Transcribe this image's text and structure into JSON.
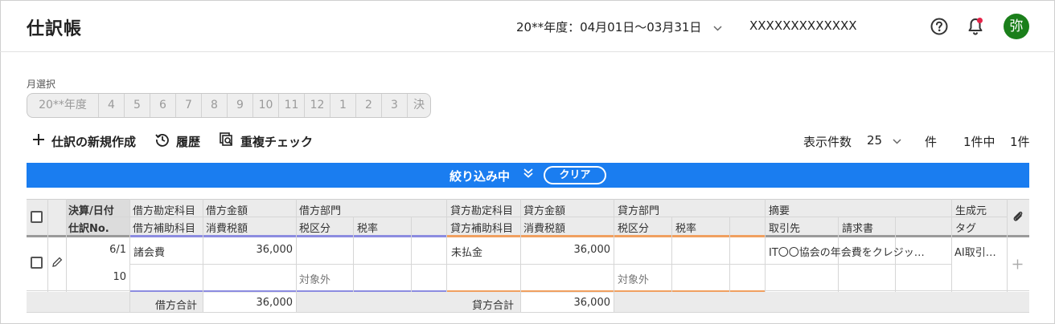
{
  "header": {
    "title": "仕訳帳",
    "fiscal_period": "20**年度：04月01日〜03月31日",
    "company": "XXXXXXXXXXXXX",
    "avatar_char": "弥"
  },
  "month_selector": {
    "label": "月選択",
    "months": [
      "20**年度",
      "4",
      "5",
      "6",
      "7",
      "8",
      "9",
      "10",
      "11",
      "12",
      "1",
      "2",
      "3",
      "決"
    ]
  },
  "toolbar": {
    "new_entry": "仕訳の新規作成",
    "history": "履歴",
    "duplicate_check": "重複チェック",
    "display_count_label": "表示件数",
    "display_count_value": "25",
    "unit": "件",
    "total_summary": "1件中",
    "range": "1件"
  },
  "filter": {
    "label": "絞り込み中",
    "clear": "クリア"
  },
  "table": {
    "headers_row1": {
      "date": "決算/日付",
      "debit_account": "借方勘定科目",
      "debit_amount": "借方金額",
      "debit_dept": "借方部門",
      "credit_account": "貸方勘定科目",
      "credit_amount": "貸方金額",
      "credit_dept": "貸方部門",
      "memo": "摘要",
      "source": "生成元"
    },
    "headers_row2": {
      "entry_no": "仕訳No.",
      "debit_sub": "借方補助科目",
      "debit_tax_amount": "消費税額",
      "debit_tax_cat": "税区分",
      "debit_tax_rate": "税率",
      "credit_sub": "貸方補助科目",
      "credit_tax_amount": "消費税額",
      "credit_tax_cat": "税区分",
      "credit_tax_rate": "税率",
      "partner": "取引先",
      "invoice": "請求書",
      "tag": "タグ"
    },
    "row": {
      "date": "6/1",
      "entry_no": "10",
      "debit_account": "諸会費",
      "debit_amount": "36,000",
      "debit_tax_cat": "対象外",
      "credit_account": "未払金",
      "credit_amount": "36,000",
      "credit_tax_cat": "対象外",
      "memo": "IT〇〇協会の年会費をクレジッ…",
      "source": "AI取引…"
    },
    "totals": {
      "debit_label": "借方合計",
      "debit_value": "36,000",
      "credit_label": "貸方合計",
      "credit_value": "36,000"
    }
  },
  "colors": {
    "filter_bar": "#1a7df0",
    "debit_accent": "#8c8ce0",
    "credit_accent": "#f0a060",
    "avatar": "#1b7f1b",
    "notification_dot": "#e6244a"
  },
  "icons": [
    "help-icon",
    "bell-icon",
    "plus-icon",
    "history-icon",
    "duplicate-search-icon",
    "chevron-down-icon",
    "double-chevron-down-icon",
    "paperclip-icon",
    "pencil-icon"
  ]
}
